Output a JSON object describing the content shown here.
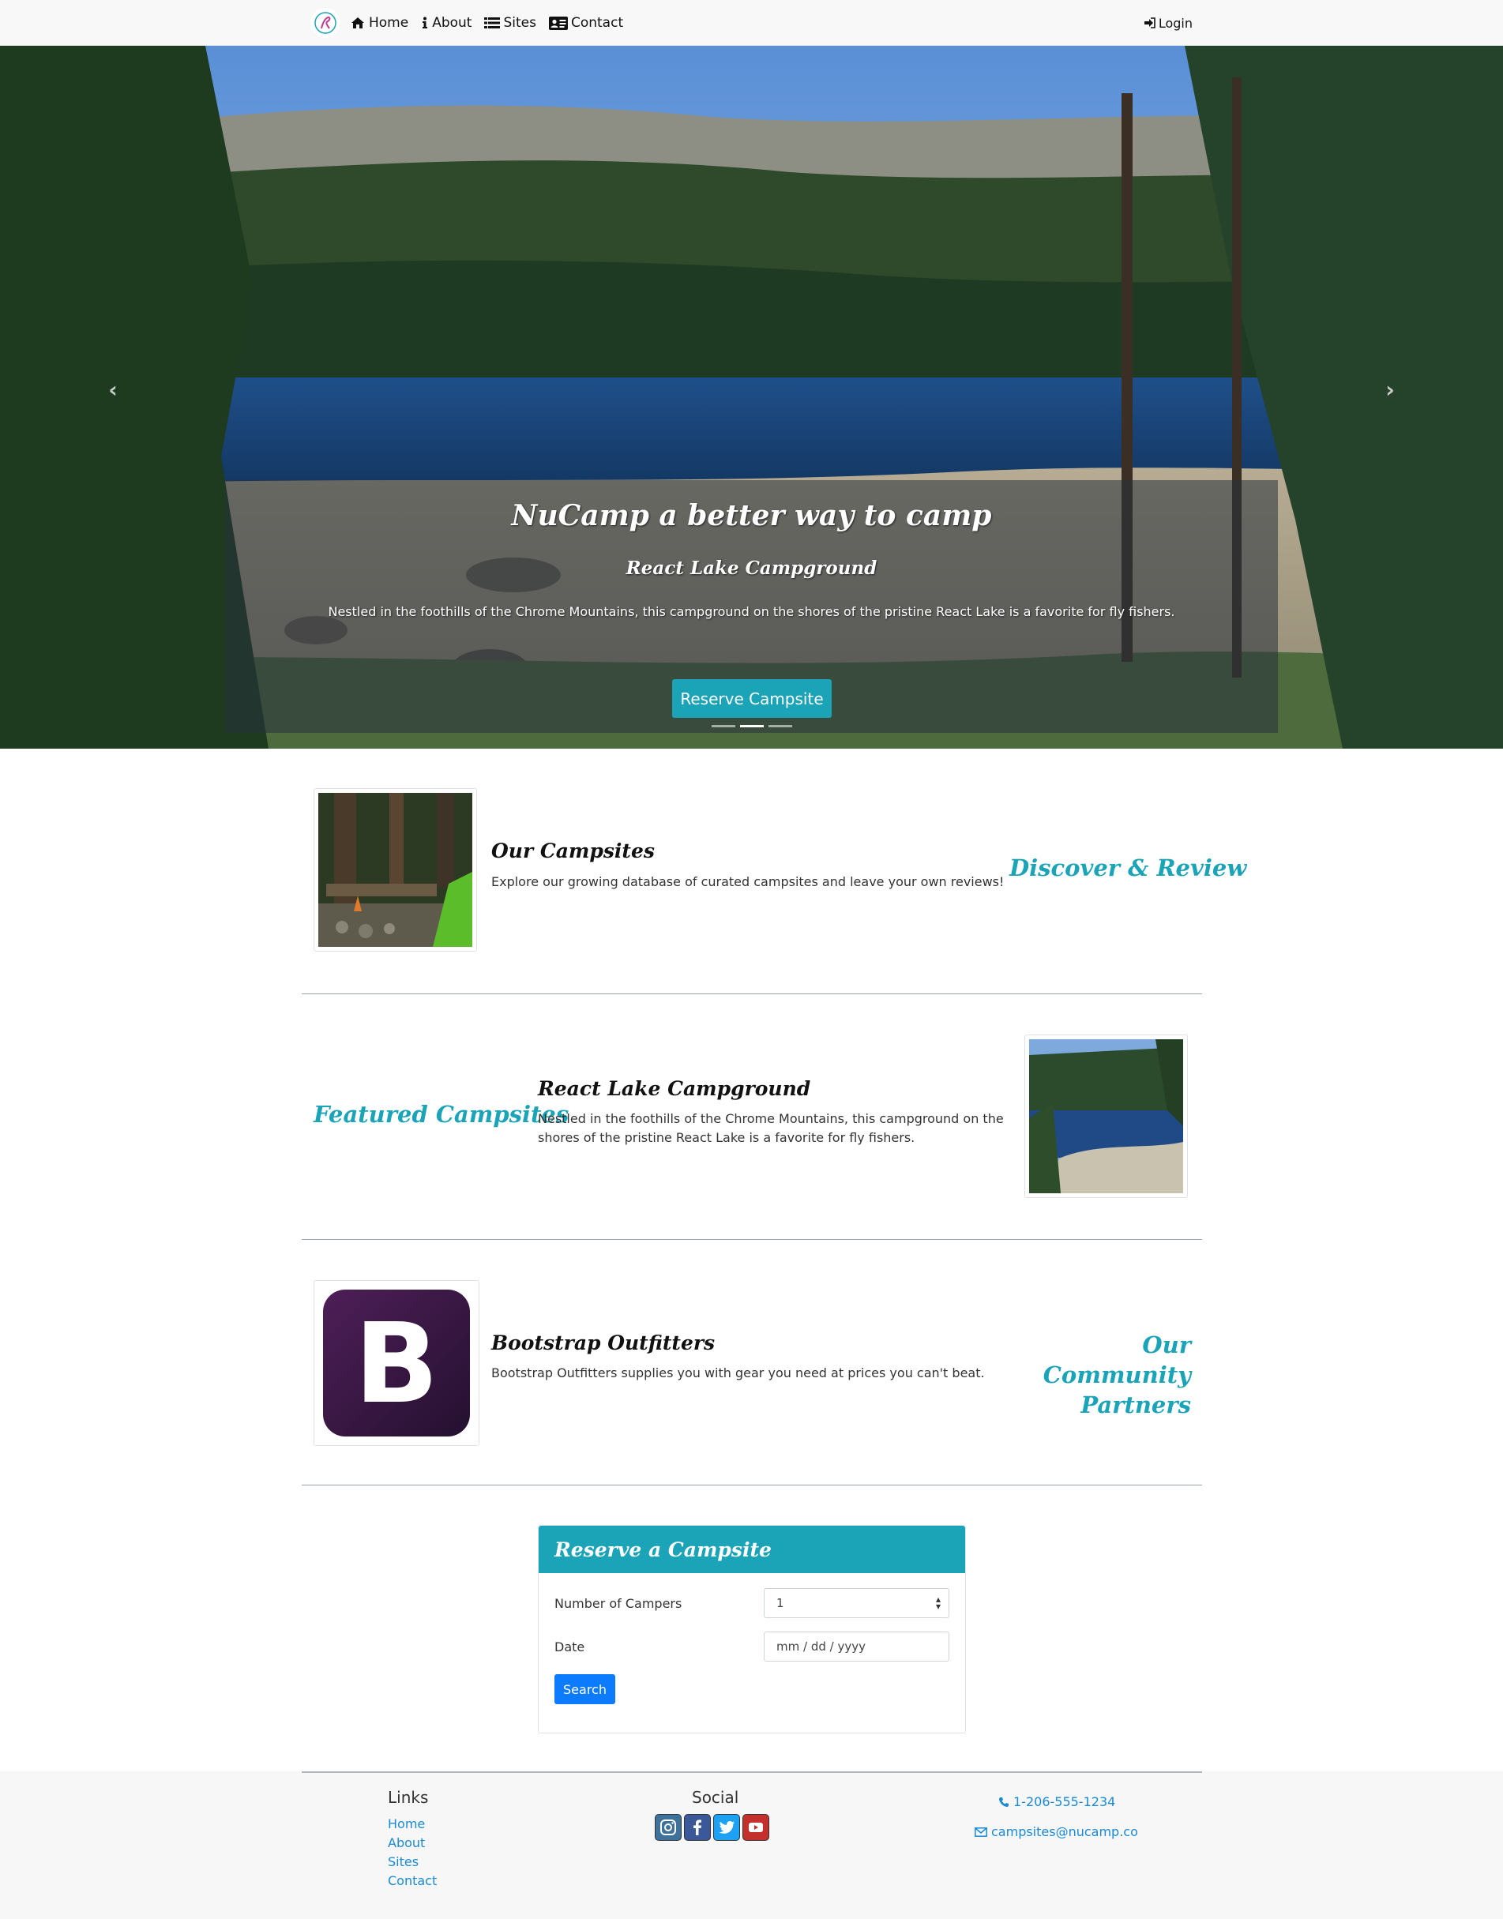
{
  "nav": {
    "links": [
      {
        "label": "Home",
        "icon": "home-icon"
      },
      {
        "label": "About",
        "icon": "info-icon"
      },
      {
        "label": "Sites",
        "icon": "list-icon"
      },
      {
        "label": "Contact",
        "icon": "address-card-icon"
      }
    ],
    "login": "Login"
  },
  "hero": {
    "title": "NuCamp a better way to camp",
    "subtitle": "React Lake Campground",
    "text": "Nestled in the foothills of the Chrome Mountains, this campground on the shores of the pristine React Lake is a favorite for fly fishers.",
    "button": "Reserve Campsite",
    "slides": 3,
    "active_slide": 2
  },
  "sections": [
    {
      "title": "Our Campsites",
      "text": "Explore our growing database of curated campsites and leave your own reviews!",
      "side": "Discover & Review"
    },
    {
      "title": "React Lake Campground",
      "text_lines": [
        "Nestled in the foothills of the Chrome Mountains, this campground on the",
        "shores of the pristine React Lake is a favorite for fly fishers."
      ],
      "side": "Featured Campsites"
    },
    {
      "title": "Bootstrap Outfitters",
      "text": "Bootstrap Outfitters supplies you with gear you need at prices you can't beat.",
      "side_lines": [
        "Our Community",
        "Partners"
      ],
      "logo_letter": "B"
    }
  ],
  "reserve": {
    "header": "Reserve a Campsite",
    "campers_label": "Number of Campers",
    "campers_value": "1",
    "date_label": "Date",
    "date_placeholder": "mm / dd / yyyy",
    "search": "Search"
  },
  "footer": {
    "links_title": "Links",
    "links": [
      "Home",
      "About",
      "Sites",
      "Contact"
    ],
    "social_title": "Social",
    "social": [
      "instagram-icon",
      "facebook-icon",
      "twitter-icon",
      "youtube-icon"
    ],
    "phone": "1-206-555-1234",
    "email": "campsites@nucamp.co"
  },
  "colors": {
    "accent": "#1ba3b8",
    "primary": "#0d7bff",
    "link": "#1a8ad6",
    "bootstrap_purple": "#3d1a4e"
  }
}
